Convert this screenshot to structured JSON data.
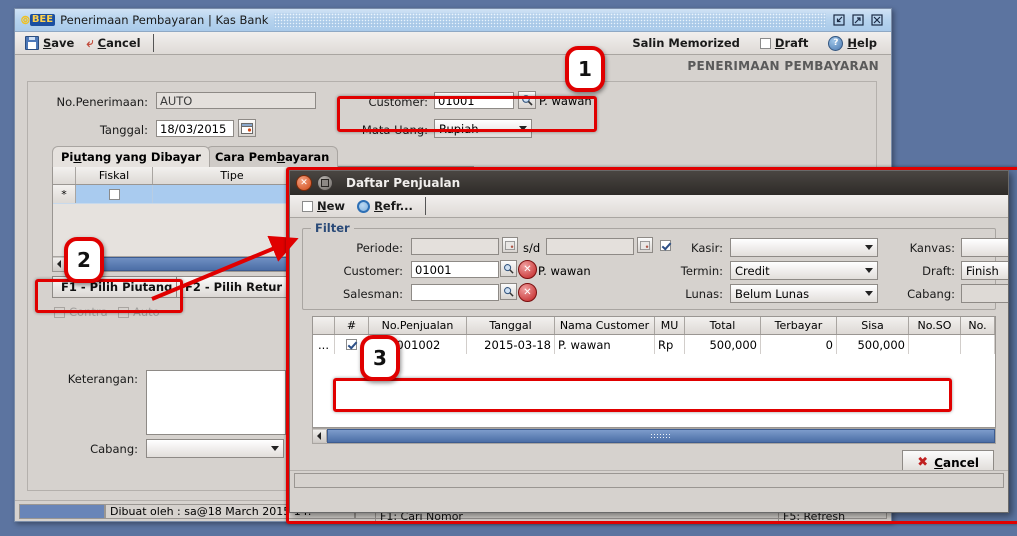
{
  "window": {
    "title": "Penerimaan Pembayaran | Kas Bank",
    "logo_text": "BEE",
    "buttons": {
      "minimize": "minimize",
      "maximize": "maximize",
      "close": "close"
    }
  },
  "toolbar": {
    "save": "Save",
    "cancel": "Cancel",
    "salin_memorized": "Salin Memorized",
    "draft": "Draft",
    "help": "Help"
  },
  "page": {
    "heading": "PENERIMAAN PEMBAYARAN"
  },
  "form": {
    "no_penerimaan_label": "No.Penerimaan:",
    "no_penerimaan_value": "AUTO",
    "tanggal_label": "Tanggal:",
    "tanggal_value": "18/03/2015",
    "customer_label": "Customer:",
    "customer_code": "01001",
    "customer_name": "P. wawan",
    "mata_uang_label": "Mata Uang:",
    "mata_uang_value": "Rupiah",
    "keterangan_label": "Keterangan:",
    "keterangan_value": "",
    "cabang_label": "Cabang:",
    "cabang_value": "",
    "contra_label": "Contra",
    "auto_label": "Auto"
  },
  "tabs": [
    {
      "label": "Piutang yang Dibayar",
      "active": true
    },
    {
      "label": "Cara Pembayaran",
      "active": false
    }
  ],
  "main_grid": {
    "columns": [
      "",
      "Fiskal",
      "Tipe",
      ""
    ],
    "rows": [
      {
        "marker": "*",
        "fiskal": false,
        "tipe": ""
      }
    ]
  },
  "action_buttons": {
    "f1": "F1 - Pilih Piutang",
    "f2": "F2 - Pilih Retur"
  },
  "statusbar": {
    "created_by": "Dibuat oleh : sa@18 March 2015  14:",
    "f1_hint": "F1: Cari Nomor",
    "f5_hint": "F5: Refresh"
  },
  "dialog": {
    "title": "Daftar Penjualan",
    "toolbar": {
      "new": "New",
      "refresh": "Refr..."
    },
    "filter": {
      "legend": "Filter",
      "periode_label": "Periode:",
      "periode_from": "",
      "periode_sd": "s/d",
      "periode_to": "",
      "periode_checked": true,
      "customer_label": "Customer:",
      "customer_code": "01001",
      "customer_name": "P. wawan",
      "salesman_label": "Salesman:",
      "salesman_value": "",
      "kasir_label": "Kasir:",
      "kasir_value": "",
      "termin_label": "Termin:",
      "termin_value": "Credit",
      "lunas_label": "Lunas:",
      "lunas_value": "Belum Lunas",
      "kanvas_label": "Kanvas:",
      "kanvas_value": "",
      "draft_label": "Draft:",
      "draft_value": "Finish",
      "cabang_label": "Cabang:",
      "cabang_value": ""
    },
    "table": {
      "columns": [
        "",
        "#",
        "No.Penjualan",
        "Tanggal",
        "Nama Customer",
        "MU",
        "Total",
        "Terbayar",
        "Sisa",
        "No.SO",
        "No."
      ],
      "rows": [
        {
          "lead": "...",
          "checked": true,
          "no_penjualan": "JL00001002",
          "tanggal": "2015-03-18",
          "nama_customer": "P. wawan",
          "mu": "Rp",
          "total": "500,000",
          "terbayar": "0",
          "sisa": "500,000",
          "no_so": "",
          "no": ""
        }
      ]
    },
    "cancel_button": "Cancel"
  },
  "annotations": {
    "badges": [
      "1",
      "2",
      "3"
    ],
    "accent_color": "#e00000"
  }
}
